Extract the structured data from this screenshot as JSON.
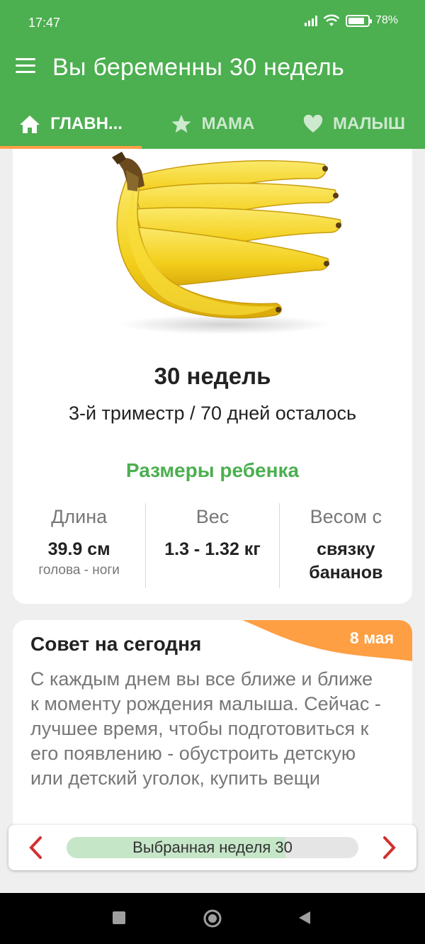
{
  "status_bar": {
    "time": "17:47",
    "battery": "78"
  },
  "app_bar": {
    "title": "Вы беременны 30 недель"
  },
  "tabs": [
    {
      "label": "ГЛАВН...",
      "icon": "home-icon",
      "active": true
    },
    {
      "label": "МАМА",
      "icon": "star-icon",
      "active": false
    },
    {
      "label": "МАЛЫШ",
      "icon": "heart-icon",
      "active": false
    }
  ],
  "summary": {
    "image": "bananas-image",
    "weeks": "30 недель",
    "trimester": "3-й триместр / 70 дней осталось",
    "sizes_title": "Размеры ребенка",
    "length": {
      "label": "Длина",
      "value": "39.9 см",
      "sub": "голова - ноги"
    },
    "weight": {
      "label": "Вес",
      "value": "1.3 - 1.32 кг"
    },
    "comparison": {
      "label": "Весом с",
      "value_line1": "связку",
      "value_line2": "бананов"
    }
  },
  "tip": {
    "title": "Совет на сегодня",
    "date": "8 мая",
    "text": "С каждым днем вы все ближе и ближе к моменту рождения малыша. Сейчас - лучшее время, чтобы подготовиться к его появлению - обустроить детскую или детский уголок, купить вещи"
  },
  "week_nav": {
    "label": "Выбранная неделя 30",
    "progress_fraction": 0.75
  },
  "colors": {
    "primary": "#4caf50",
    "accent": "#ff9f43",
    "nav_arrow": "#d32f2f"
  }
}
